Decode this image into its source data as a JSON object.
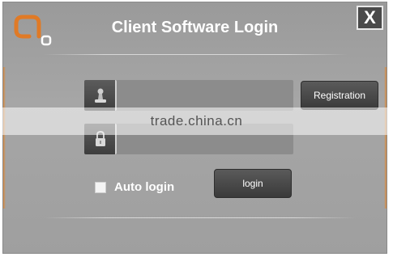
{
  "window": {
    "title": "Client Software Login",
    "close_label": "X"
  },
  "logo": {
    "icon": "brand-logo-icon",
    "accent": "#e07a26"
  },
  "form": {
    "username": {
      "icon": "user-icon",
      "value": ""
    },
    "password": {
      "icon": "lock-icon",
      "value": ""
    },
    "registration_label": "Registration",
    "auto_login_label": "Auto login",
    "auto_login_checked": false,
    "login_label": "login"
  },
  "watermark": {
    "text": "trade.china.cn"
  }
}
